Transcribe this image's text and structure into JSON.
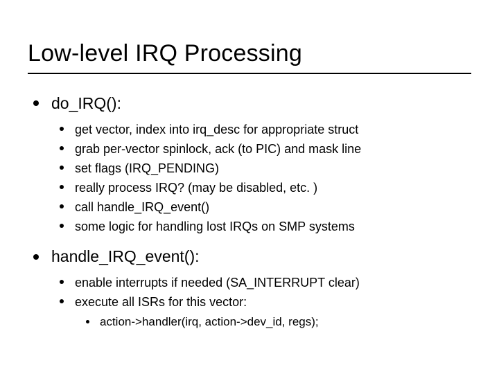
{
  "title": "Low-level IRQ Processing",
  "sections": [
    {
      "heading": "do_IRQ():",
      "items": [
        "get vector, index into irq_desc for appropriate struct",
        "grab per-vector spinlock, ack (to PIC) and mask line",
        "set flags (IRQ_PENDING)",
        "really process IRQ? (may be disabled, etc. )",
        "call handle_IRQ_event()",
        "some logic for handling lost IRQs on SMP systems"
      ]
    },
    {
      "heading": "handle_IRQ_event():",
      "items": [
        "enable interrupts if needed (SA_INTERRUPT clear)",
        "execute all ISRs for this vector:"
      ],
      "subitems_of_last": [
        "action->handler(irq, action->dev_id, regs);"
      ]
    }
  ]
}
